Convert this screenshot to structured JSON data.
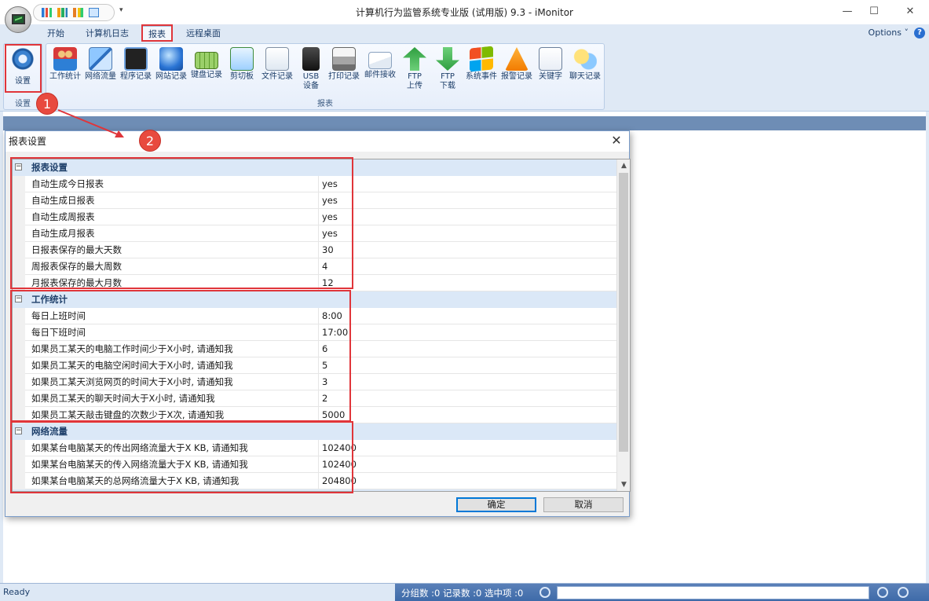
{
  "window": {
    "title": "计算机行为监管系统专业版 (试用版) 9.3 - iMonitor",
    "minimize": "—",
    "maximize": "☐",
    "close": "✕"
  },
  "tabs": [
    {
      "label": "开始",
      "active": false
    },
    {
      "label": "计算机日志",
      "active": false
    },
    {
      "label": "报表",
      "active": true
    },
    {
      "label": "远程桌面",
      "active": false
    }
  ],
  "options_label": "Options ˅",
  "help_icon": "?",
  "ribbon": {
    "settings_group": {
      "button_label": "设置",
      "group_label": "设置"
    },
    "report_group": {
      "group_label": "报表",
      "buttons": [
        {
          "label": "工作统计",
          "icon": "people-icon"
        },
        {
          "label": "网络流量",
          "icon": "network-icon"
        },
        {
          "label": "程序记录",
          "icon": "cmd-icon"
        },
        {
          "label": "网站记录",
          "icon": "globe-icon"
        },
        {
          "label": "键盘记录",
          "icon": "keyboard-icon"
        },
        {
          "label": "剪切板",
          "icon": "clipboard-icon"
        },
        {
          "label": "文件记录",
          "icon": "file-icon"
        },
        {
          "label": "USB\n设备",
          "icon": "usb-icon"
        },
        {
          "label": "打印记录",
          "icon": "printer-icon"
        },
        {
          "label": "邮件接收",
          "icon": "mail-icon"
        },
        {
          "label": "FTP\n上传",
          "icon": "upload-arrow-icon"
        },
        {
          "label": "FTP\n下载",
          "icon": "download-arrow-icon"
        },
        {
          "label": "系统事件",
          "icon": "windows-icon"
        },
        {
          "label": "报警记录",
          "icon": "warning-icon"
        },
        {
          "label": "关键字",
          "icon": "document-icon"
        },
        {
          "label": "聊天记录",
          "icon": "chat-icon"
        }
      ]
    }
  },
  "markers": {
    "one": "1",
    "two": "2"
  },
  "dialog": {
    "title": "报表设置",
    "close": "✕",
    "categories": [
      {
        "label": "报表设置",
        "rows": [
          {
            "name": "自动生成今日报表",
            "value": "yes"
          },
          {
            "name": "自动生成日报表",
            "value": "yes"
          },
          {
            "name": "自动生成周报表",
            "value": "yes"
          },
          {
            "name": "自动生成月报表",
            "value": "yes"
          },
          {
            "name": "日报表保存的最大天数",
            "value": "30"
          },
          {
            "name": "周报表保存的最大周数",
            "value": "4"
          },
          {
            "name": "月报表保存的最大月数",
            "value": "12"
          }
        ]
      },
      {
        "label": "工作统计",
        "rows": [
          {
            "name": "每日上班时间",
            "value": "8:00"
          },
          {
            "name": "每日下班时间",
            "value": "17:00"
          },
          {
            "name": "如果员工某天的电脑工作时间少于X小时, 请通知我",
            "value": "6"
          },
          {
            "name": "如果员工某天的电脑空闲时间大于X小时, 请通知我",
            "value": "5"
          },
          {
            "name": "如果员工某天浏览网页的时间大于X小时, 请通知我",
            "value": "3"
          },
          {
            "name": "如果员工某天的聊天时间大于X小时, 请通知我",
            "value": "2"
          },
          {
            "name": "如果员工某天敲击键盘的次数少于X次, 请通知我",
            "value": "5000"
          }
        ]
      },
      {
        "label": "网络流量",
        "rows": [
          {
            "name": "如果某台电脑某天的传出网络流量大于X KB, 请通知我",
            "value": "102400"
          },
          {
            "name": "如果某台电脑某天的传入网络流量大于X KB, 请通知我",
            "value": "102400"
          },
          {
            "name": "如果某台电脑某天的总网络流量大于X KB, 请通知我",
            "value": "204800"
          }
        ]
      }
    ],
    "ok_label": "确定",
    "cancel_label": "取消"
  },
  "status": {
    "ready": "Ready",
    "counts": "分组数 :0  记录数 :0  选中项 :0"
  },
  "colors": {
    "highlight_red": "#e0353a",
    "ribbon_bg": "#dfe9f5",
    "category_bg": "#dbe8f7",
    "status_blue": "#3d6aa8"
  }
}
